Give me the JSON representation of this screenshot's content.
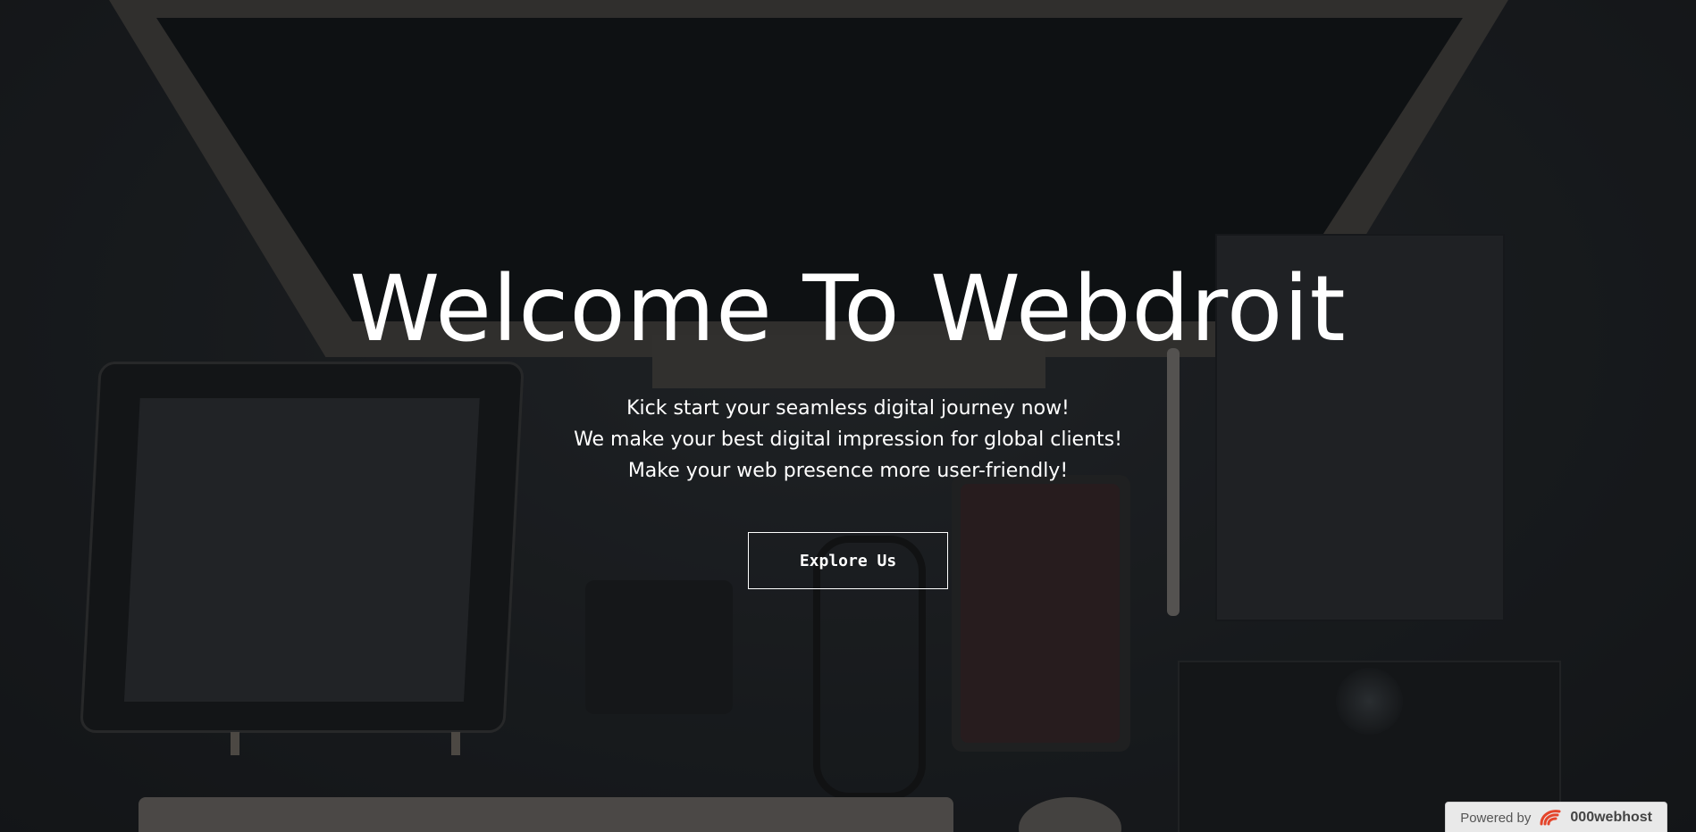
{
  "hero": {
    "title": "Welcome To Webdroit",
    "lines": [
      "Kick start your seamless digital journey now!",
      "We make your best digital impression for global clients!",
      "Make your web presence more user-friendly!"
    ],
    "cta_label": "Explore Us"
  },
  "footer_badge": {
    "prefix": "Powered by",
    "brand": "000webhost",
    "logo_icon": "000webhost-logo-icon",
    "logo_color": "#e4452b"
  },
  "colors": {
    "text": "#ffffff",
    "overlay": "#141618",
    "badge_bg": "#e9e9e9"
  }
}
